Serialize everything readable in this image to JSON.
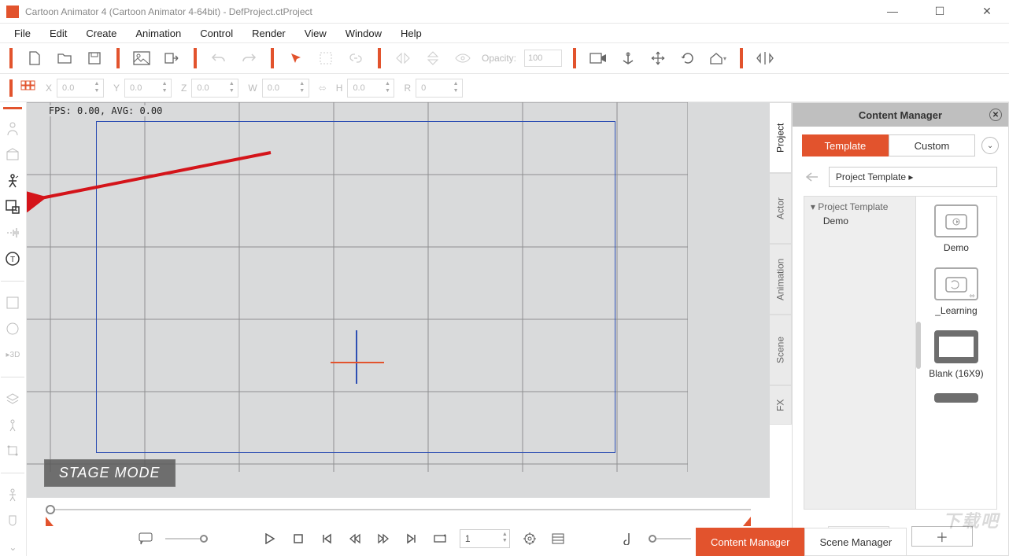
{
  "title": "Cartoon Animator 4  (Cartoon Animator 4-64bit) - DefProject.ctProject",
  "menu": [
    "File",
    "Edit",
    "Create",
    "Animation",
    "Control",
    "Render",
    "View",
    "Window",
    "Help"
  ],
  "opacity_label": "Opacity:",
  "opacity_value": "100",
  "coords": {
    "X": "0.0",
    "Y": "0.0",
    "Z": "0.0",
    "W": "0.0",
    "H": "0.0",
    "R": "0"
  },
  "fps": "FPS: 0.00, AVG: 0.00",
  "stage_mode": "STAGE MODE",
  "frame_current": "1",
  "content_manager": {
    "header": "Content Manager",
    "tabs": {
      "template": "Template",
      "custom": "Custom"
    },
    "vtabs": [
      "Project",
      "Actor",
      "Animation",
      "Scene",
      "FX"
    ],
    "breadcrumb": "Project Template ▸",
    "tree_header": "Project Template",
    "tree_items": [
      "Demo"
    ],
    "thumbs": [
      "Demo",
      "_Learning",
      "Blank (16X9)"
    ]
  },
  "bottom_tabs": {
    "cm": "Content Manager",
    "sm": "Scene Manager"
  },
  "watermark": "下载吧"
}
